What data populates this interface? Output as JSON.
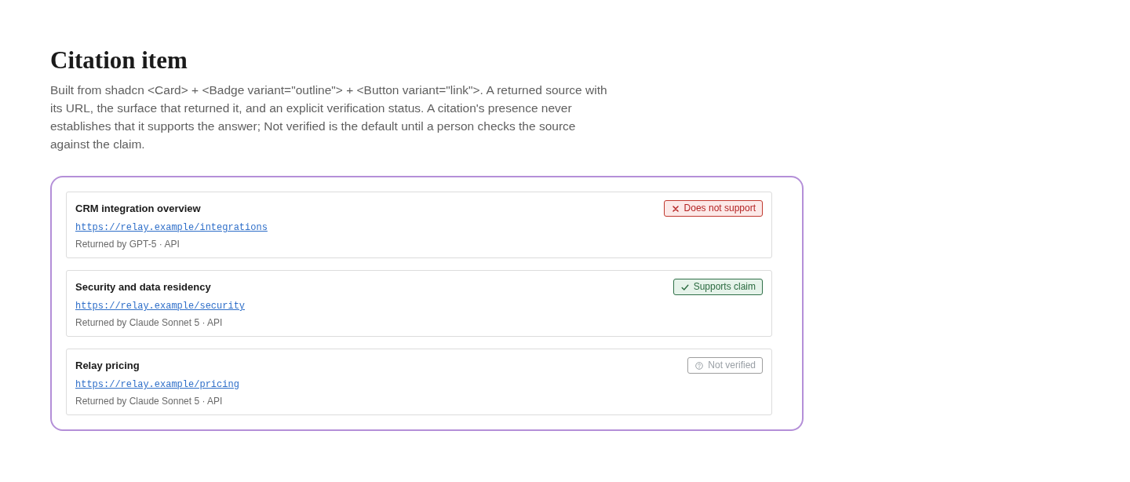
{
  "page": {
    "title": "Citation item",
    "description": "Built from shadcn <Card> + <Badge variant=\"outline\"> + <Button variant=\"link\">. A returned source with its URL, the surface that returned it, and an explicit verification status. A citation's presence never establishes that it supports the answer; Not verified is the default until a person checks the source against the claim."
  },
  "citations": [
    {
      "title": "CRM integration overview",
      "url": "https://relay.example/integrations",
      "returned_by": "Returned by GPT-5 · API",
      "status": {
        "kind": "refutes",
        "label": "Does not support"
      }
    },
    {
      "title": "Security and data residency",
      "url": "https://relay.example/security",
      "returned_by": "Returned by Claude Sonnet 5 · API",
      "status": {
        "kind": "supports",
        "label": "Supports claim"
      }
    },
    {
      "title": "Relay pricing",
      "url": "https://relay.example/pricing",
      "returned_by": "Returned by Claude Sonnet 5 · API",
      "status": {
        "kind": "unverified",
        "label": "Not verified"
      }
    }
  ]
}
